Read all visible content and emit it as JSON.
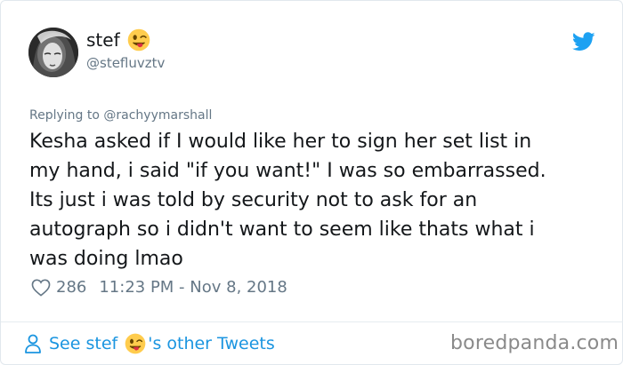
{
  "tweet": {
    "author": {
      "display_name": "stef",
      "emoji_icon": "winking-tongue-face-emoji",
      "handle": "@stefluvztv",
      "avatar_icon": "profile-photo"
    },
    "logo_icon": "twitter-bird-icon",
    "reply_prefix": "Replying to",
    "reply_handle": "@rachyymarshall",
    "text": "Kesha asked if I would like her to sign her set list in\nmy hand, i said \"if you want!\" I was so embarrassed.\nIts just i was told by security not to ask for an\nautograph so i didn't want to seem like thats what i\nwas doing lmao",
    "likes": "286",
    "timestamp": "11:23 PM - Nov 8, 2018"
  },
  "footer": {
    "see_prefix": "See stef",
    "see_suffix": "'s other Tweets",
    "watermark": "boredpanda.com"
  },
  "colors": {
    "link_blue": "#1b95e0",
    "muted_gray": "#657786",
    "text": "#14171a"
  }
}
